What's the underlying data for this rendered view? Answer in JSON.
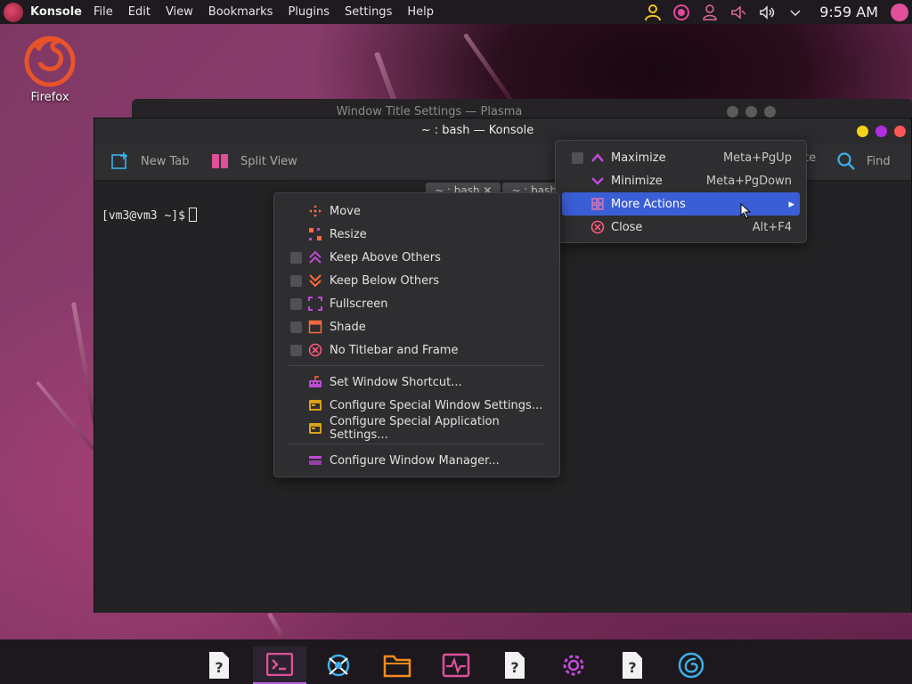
{
  "top_panel": {
    "app_name": "Konsole",
    "menu": [
      "File",
      "Edit",
      "View",
      "Bookmarks",
      "Plugins",
      "Settings",
      "Help"
    ],
    "clock": "9:59 AM"
  },
  "desktop": {
    "icon_label": "Firefox"
  },
  "background_window": {
    "title": "Window Title Settings — Plasma"
  },
  "konsole": {
    "title": "~ : bash — Konsole",
    "toolbar": {
      "new_tab": "New Tab",
      "split_view": "Split View",
      "paste_partial": "te",
      "find": "Find"
    },
    "tabs": [
      "~ : bash",
      "~ : bash"
    ],
    "prompt": "[vm3@vm3 ~]$"
  },
  "window_menu": {
    "items": [
      {
        "label": "Maximize",
        "shortcut": "Meta+PgUp"
      },
      {
        "label": "Minimize",
        "shortcut": "Meta+PgDown"
      },
      {
        "label": "More Actions",
        "shortcut": ""
      },
      {
        "label": "Close",
        "shortcut": "Alt+F4"
      }
    ]
  },
  "more_actions_menu": {
    "items": [
      {
        "label": "Move"
      },
      {
        "label": "Resize"
      },
      {
        "label": "Keep Above Others"
      },
      {
        "label": "Keep Below Others"
      },
      {
        "label": "Fullscreen"
      },
      {
        "label": "Shade"
      },
      {
        "label": "No Titlebar and Frame"
      },
      {
        "label": "Set Window Shortcut..."
      },
      {
        "label": "Configure Special Window Settings..."
      },
      {
        "label": "Configure Special Application Settings..."
      },
      {
        "label": "Configure Window Manager..."
      }
    ]
  },
  "taskbar": {
    "items": [
      "unknown-app-icon",
      "konsole-icon",
      "network-icon",
      "files-icon",
      "system-monitor-icon",
      "unknown-app-icon",
      "settings-icon",
      "unknown-app-icon",
      "discover-icon"
    ],
    "active_index": 1
  },
  "colors": {
    "accent_highlight": "#3a5ed6",
    "close_red": "#ff5555",
    "maximize_purple": "#b02ee0",
    "minimize_yellow": "#f5d31a",
    "taskbar_active": "#b95fe0"
  }
}
